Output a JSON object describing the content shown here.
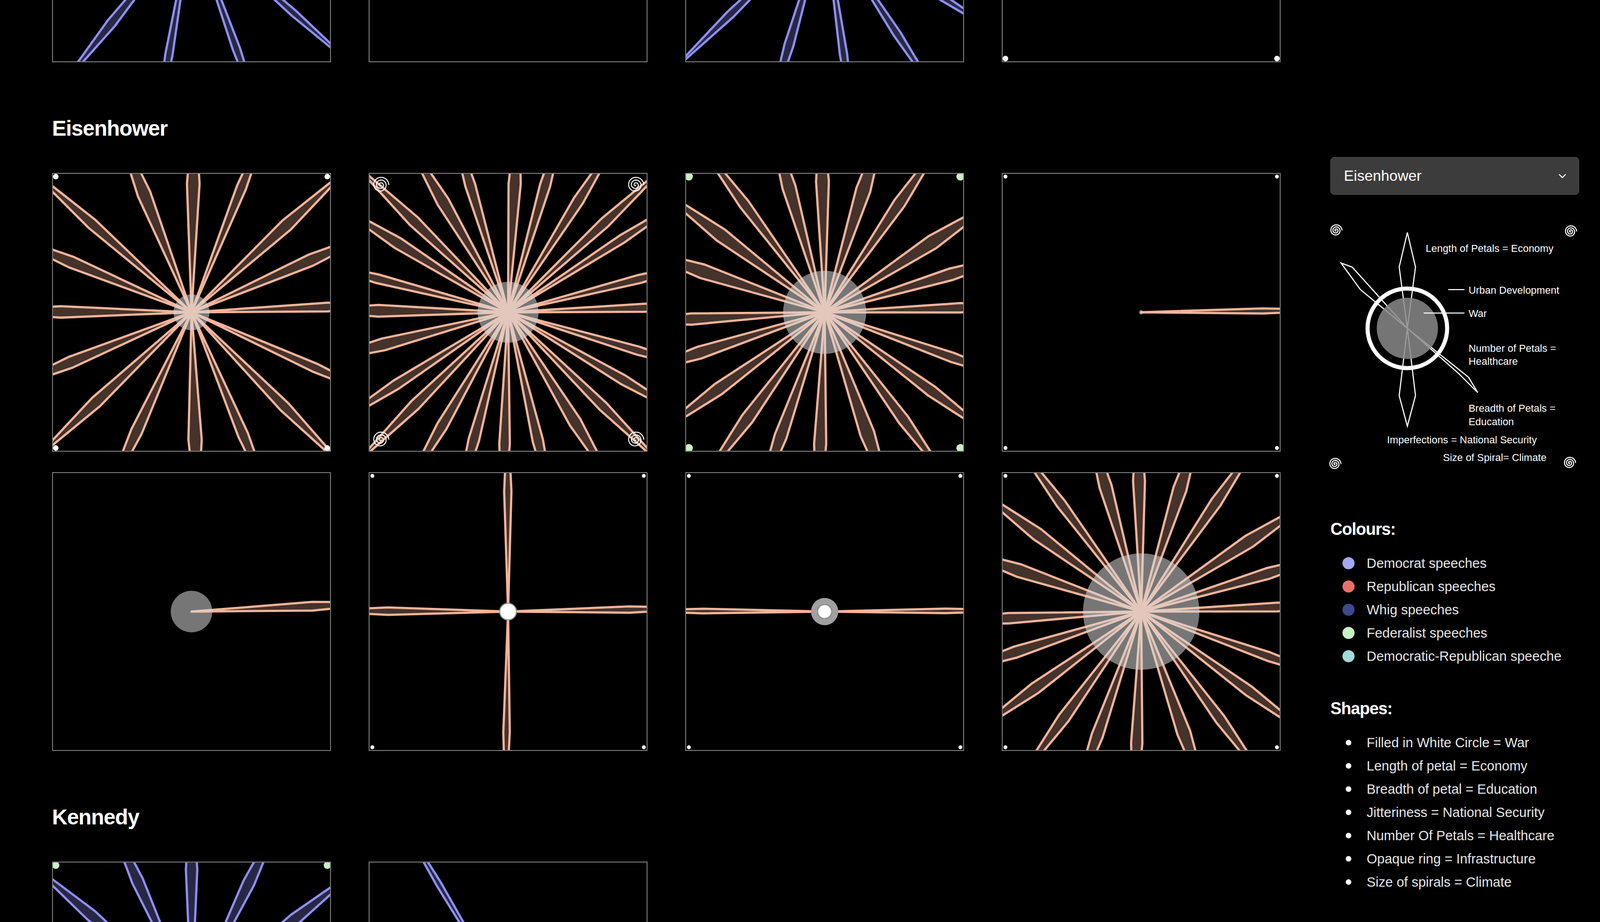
{
  "sections": [
    {
      "title": null,
      "tiles": [
        {
          "party": "Democrat",
          "color": "#8f8ff5",
          "petals": 12,
          "length": 0.95,
          "breadth": 0.3,
          "jitter": 0.3,
          "rotation": 10,
          "circle": 0.1,
          "war": false,
          "ring": false,
          "marks": "none",
          "mark_size": 0,
          "mark_color": "#ffffff"
        },
        {
          "party": "Democrat",
          "color": "#8f8ff5",
          "petals": 0,
          "length": 0,
          "breadth": 0,
          "jitter": 0,
          "rotation": 0,
          "circle": 0,
          "war": false,
          "ring": false,
          "marks": "none",
          "mark_size": 0,
          "mark_color": "#ffffff"
        },
        {
          "party": "Democrat",
          "color": "#8f8ff5",
          "petals": 14,
          "length": 0.95,
          "breadth": 0.3,
          "jitter": 0.35,
          "rotation": 5,
          "circle": 0.1,
          "war": false,
          "ring": false,
          "marks": "none",
          "mark_size": 0,
          "mark_color": "#ffffff"
        },
        {
          "party": "Democrat",
          "color": "#8f8ff5",
          "petals": 0,
          "length": 0,
          "breadth": 0,
          "jitter": 0,
          "rotation": 0,
          "circle": 0,
          "war": false,
          "ring": false,
          "marks": "dot",
          "mark_size": 0.4,
          "mark_color": "#ffffff"
        }
      ]
    },
    {
      "title": "Eisenhower",
      "tiles": [
        {
          "party": "Republican",
          "color": "#f4b49a",
          "petals": 16,
          "length": 0.95,
          "breadth": 0.5,
          "jitter": 0.35,
          "rotation": 0,
          "circle": 0.13,
          "war": false,
          "ring": false,
          "marks": "dot",
          "mark_size": 0.4,
          "mark_color": "#ffffff"
        },
        {
          "party": "Republican",
          "color": "#f4b49a",
          "petals": 24,
          "length": 0.95,
          "breadth": 0.45,
          "jitter": 0.3,
          "rotation": 0,
          "circle": 0.22,
          "war": false,
          "ring": false,
          "marks": "spiral",
          "mark_size": 0.5,
          "mark_color": "#ffffff"
        },
        {
          "party": "Republican",
          "color": "#f4b49a",
          "petals": 20,
          "length": 0.95,
          "breadth": 0.55,
          "jitter": 0.3,
          "rotation": 0,
          "circle": 0.3,
          "war": false,
          "ring": false,
          "marks": "dot",
          "mark_size": 0.7,
          "mark_color": "#c8f0c8"
        },
        {
          "party": "Republican",
          "color": "#f4b49a",
          "petals": 1,
          "length": 0.8,
          "breadth": 0.2,
          "jitter": 0.1,
          "rotation": 0,
          "circle": 0.016,
          "war": false,
          "ring": false,
          "marks": "dot",
          "mark_size": 0.2,
          "mark_color": "#ffffff"
        },
        {
          "party": "Republican",
          "color": "#f4b49a",
          "petals": 1,
          "length": 0.8,
          "breadth": 0.5,
          "jitter": 0.4,
          "rotation": 0,
          "circle": 0.15,
          "war": false,
          "ring": false,
          "marks": "none",
          "mark_size": 0,
          "mark_color": "#ffffff"
        },
        {
          "party": "Republican",
          "color": "#f4b49a",
          "petals": 4,
          "length": 0.8,
          "breadth": 0.3,
          "jitter": 0.15,
          "rotation": 0,
          "circle": 0.06,
          "war": true,
          "ring": false,
          "marks": "dot",
          "mark_size": 0.2,
          "mark_color": "#ffffff"
        },
        {
          "party": "Republican",
          "color": "#f4b49a",
          "petals": 2,
          "length": 0.8,
          "breadth": 0.15,
          "jitter": 0.05,
          "rotation": 0,
          "circle": 0.05,
          "war": true,
          "ring": true,
          "marks": "dot",
          "mark_size": 0.2,
          "mark_color": "#ffffff"
        },
        {
          "party": "Republican",
          "color": "#f4b49a",
          "petals": 20,
          "length": 0.95,
          "breadth": 0.5,
          "jitter": 0.3,
          "rotation": 0,
          "circle": 0.42,
          "war": false,
          "ring": false,
          "marks": "dot",
          "mark_size": 0.2,
          "mark_color": "#ffffff"
        }
      ]
    },
    {
      "title": "Kennedy",
      "tiles": [
        {
          "party": "Democrat",
          "color": "#8f8ff5",
          "petals": 14,
          "length": 0.95,
          "breadth": 0.5,
          "jitter": 0.3,
          "rotation": 90,
          "circle": 0.1,
          "war": false,
          "ring": false,
          "marks": "dot",
          "mark_size": 0.6,
          "mark_color": "#c8f0c8"
        },
        {
          "party": "Democrat",
          "color": "#8f8ff5",
          "petals": 1,
          "length": 0.95,
          "breadth": 0.2,
          "jitter": 0.1,
          "rotation": -120,
          "circle": 0.05,
          "war": false,
          "ring": false,
          "marks": "none",
          "mark_size": 0,
          "mark_color": "#ffffff"
        }
      ]
    }
  ],
  "select": {
    "value": "Eisenhower"
  },
  "legend": {
    "labels": [
      {
        "lines": [
          "Length of Petals = Economy"
        ]
      },
      {
        "lines": [
          "Urban Development"
        ]
      },
      {
        "lines": [
          "War"
        ]
      },
      {
        "lines": [
          "Number of Petals =",
          "Healthcare"
        ]
      },
      {
        "lines": [
          "Breadth of Petals =",
          "Education"
        ]
      },
      {
        "lines": [
          "Imperfections = National Security"
        ]
      },
      {
        "lines": [
          "Size of Spiral= Climate"
        ]
      }
    ]
  },
  "colours": {
    "title": "Colours:",
    "items": [
      {
        "label": "Democrat speeches",
        "color": "#a3a8f5"
      },
      {
        "label": "Republican speeches",
        "color": "#e8706a"
      },
      {
        "label": "Whig speeches",
        "color": "#3d4a8c"
      },
      {
        "label": "Federalist speeches",
        "color": "#c8f0c4"
      },
      {
        "label": "Democratic-Republican speeche",
        "color": "#a2d9d9"
      }
    ]
  },
  "shapes": {
    "title": "Shapes:",
    "items": [
      "Filled in White Circle = War",
      "Length of petal = Economy",
      "Breadth of petal = Education",
      "Jitteriness = National Security",
      "Number Of Petals = Healthcare",
      "Opaque ring = Infrastructure",
      "Size of spirals = Climate"
    ]
  }
}
